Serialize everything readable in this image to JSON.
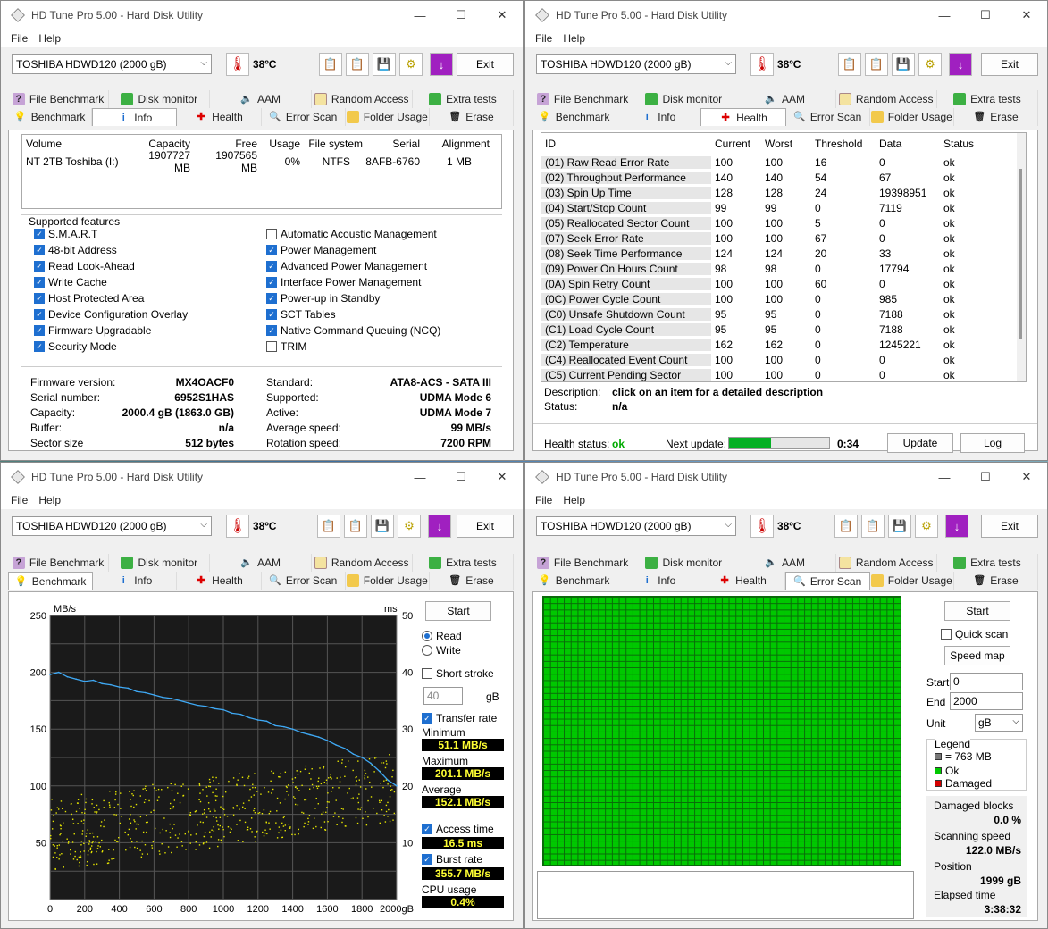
{
  "window": {
    "title": "HD Tune Pro 5.00 - Hard Disk Utility",
    "menu_file": "File",
    "menu_help": "Help",
    "exit_label": "Exit"
  },
  "drive": {
    "name": "TOSHIBA HDWD120 (2000 gB)",
    "temperature": "38ºC"
  },
  "tabs_row1": [
    "File Benchmark",
    "Disk monitor",
    "AAM",
    "Random Access",
    "Extra tests"
  ],
  "tabs_row2": [
    "Benchmark",
    "Info",
    "Health",
    "Error Scan",
    "Folder Usage",
    "Erase"
  ],
  "info": {
    "volume_headers": [
      "Volume",
      "Capacity",
      "Free",
      "Usage",
      "File system",
      "Serial",
      "Alignment"
    ],
    "volume_row": [
      "NT 2TB Toshiba (I:)",
      "1907727 MB",
      "1907565 MB",
      "0%",
      "NTFS",
      "8AFB-6760",
      "1 MB"
    ],
    "features_title": "Supported features",
    "features_left": [
      {
        "label": "S.M.A.R.T",
        "checked": true
      },
      {
        "label": "48-bit Address",
        "checked": true
      },
      {
        "label": "Read Look-Ahead",
        "checked": true
      },
      {
        "label": "Write Cache",
        "checked": true
      },
      {
        "label": "Host Protected Area",
        "checked": true
      },
      {
        "label": "Device Configuration Overlay",
        "checked": true
      },
      {
        "label": "Firmware Upgradable",
        "checked": true
      },
      {
        "label": "Security Mode",
        "checked": true
      }
    ],
    "features_right": [
      {
        "label": "Automatic Acoustic Management",
        "checked": false
      },
      {
        "label": "Power Management",
        "checked": true
      },
      {
        "label": "Advanced Power Management",
        "checked": true
      },
      {
        "label": "Interface Power Management",
        "checked": true
      },
      {
        "label": "Power-up in Standby",
        "checked": true
      },
      {
        "label": "SCT Tables",
        "checked": true
      },
      {
        "label": "Native Command Queuing (NCQ)",
        "checked": true
      },
      {
        "label": "TRIM",
        "checked": false
      }
    ],
    "specs_left": [
      {
        "label": "Firmware version:",
        "value": "MX4OACF0"
      },
      {
        "label": "Serial number:",
        "value": "6952S1HAS"
      },
      {
        "label": "Capacity:",
        "value": "2000.4 gB (1863.0 GB)"
      },
      {
        "label": "Buffer:",
        "value": "n/a"
      },
      {
        "label": "Sector size",
        "value": "512 bytes"
      }
    ],
    "specs_right": [
      {
        "label": "Standard:",
        "value": "ATA8-ACS - SATA III"
      },
      {
        "label": "Supported:",
        "value": "UDMA Mode 6"
      },
      {
        "label": "Active:",
        "value": "UDMA Mode 7"
      },
      {
        "label": "Average speed:",
        "value": "99 MB/s"
      },
      {
        "label": "Rotation speed:",
        "value": "7200 RPM"
      }
    ]
  },
  "health": {
    "headers": [
      "ID",
      "Current",
      "Worst",
      "Threshold",
      "Data",
      "Status"
    ],
    "rows": [
      [
        "(01) Raw Read Error Rate",
        "100",
        "100",
        "16",
        "0",
        "ok"
      ],
      [
        "(02) Throughput Performance",
        "140",
        "140",
        "54",
        "67",
        "ok"
      ],
      [
        "(03) Spin Up Time",
        "128",
        "128",
        "24",
        "19398951",
        "ok"
      ],
      [
        "(04) Start/Stop Count",
        "99",
        "99",
        "0",
        "7119",
        "ok"
      ],
      [
        "(05) Reallocated Sector Count",
        "100",
        "100",
        "5",
        "0",
        "ok"
      ],
      [
        "(07) Seek Error Rate",
        "100",
        "100",
        "67",
        "0",
        "ok"
      ],
      [
        "(08) Seek Time Performance",
        "124",
        "124",
        "20",
        "33",
        "ok"
      ],
      [
        "(09) Power On Hours Count",
        "98",
        "98",
        "0",
        "17794",
        "ok"
      ],
      [
        "(0A) Spin Retry Count",
        "100",
        "100",
        "60",
        "0",
        "ok"
      ],
      [
        "(0C) Power Cycle Count",
        "100",
        "100",
        "0",
        "985",
        "ok"
      ],
      [
        "(C0) Unsafe Shutdown Count",
        "95",
        "95",
        "0",
        "7188",
        "ok"
      ],
      [
        "(C1) Load Cycle Count",
        "95",
        "95",
        "0",
        "7188",
        "ok"
      ],
      [
        "(C2) Temperature",
        "162",
        "162",
        "0",
        "1245221",
        "ok"
      ],
      [
        "(C4) Reallocated Event Count",
        "100",
        "100",
        "0",
        "0",
        "ok"
      ],
      [
        "(C5) Current Pending Sector",
        "100",
        "100",
        "0",
        "0",
        "ok"
      ]
    ],
    "description_label": "Description:",
    "description_value": "click on an item for a detailed description",
    "status_label": "Status:",
    "status_value": "n/a",
    "health_status_label": "Health status:",
    "health_status_value": "ok",
    "next_update_label": "Next update:",
    "next_update_progress": 0.42,
    "next_update_time": "0:34",
    "update_button": "Update",
    "log_button": "Log"
  },
  "benchmark": {
    "start_button": "Start",
    "read_label": "Read",
    "write_label": "Write",
    "short_stroke_label": "Short stroke",
    "short_stroke_value": "40",
    "short_stroke_unit": "gB",
    "transfer_rate_label": "Transfer rate",
    "minimum_label": "Minimum",
    "minimum_value": "51.1 MB/s",
    "maximum_label": "Maximum",
    "maximum_value": "201.1 MB/s",
    "average_label": "Average",
    "average_value": "152.1 MB/s",
    "access_time_label": "Access time",
    "access_time_value": "16.5 ms",
    "burst_rate_label": "Burst rate",
    "burst_rate_value": "355.7 MB/s",
    "cpu_usage_label": "CPU usage",
    "cpu_usage_value": "0.4%"
  },
  "chart_data": {
    "type": "line",
    "ylabel": "MB/s",
    "y2label": "ms",
    "xlabel_unit": "gB",
    "ylim": [
      0,
      250
    ],
    "y2lim": [
      0,
      50
    ],
    "xlim": [
      0,
      2000
    ],
    "x_ticks": [
      "0",
      "200",
      "400",
      "600",
      "800",
      "1000",
      "1200",
      "1400",
      "1600",
      "1800",
      "2000gB"
    ],
    "y_ticks": [
      "50",
      "100",
      "150",
      "200",
      "250"
    ],
    "y2_ticks": [
      "10",
      "20",
      "30",
      "40",
      "50"
    ],
    "series": [
      {
        "color": "#3fa9f5",
        "x": [
          0,
          50,
          100,
          150,
          200,
          250,
          300,
          350,
          400,
          450,
          500,
          550,
          600,
          650,
          700,
          750,
          800,
          850,
          900,
          950,
          1000,
          1050,
          1100,
          1150,
          1200,
          1250,
          1300,
          1350,
          1400,
          1450,
          1500,
          1550,
          1600,
          1650,
          1700,
          1750,
          1800,
          1850,
          1900,
          1950,
          2000
        ],
        "y": [
          198,
          200,
          196,
          194,
          192,
          193,
          190,
          189,
          187,
          186,
          183,
          182,
          180,
          178,
          177,
          175,
          173,
          171,
          170,
          168,
          167,
          164,
          163,
          160,
          158,
          157,
          153,
          152,
          150,
          147,
          145,
          143,
          140,
          136,
          133,
          128,
          125,
          120,
          113,
          105,
          100
        ]
      },
      {
        "color": "#e6e600",
        "type": "scatter",
        "x_range": [
          0,
          2000
        ],
        "y2_range_start": [
          5,
          18
        ],
        "y2_range_end": [
          14,
          26
        ]
      }
    ]
  },
  "error_scan": {
    "start_button": "Start",
    "quick_scan_label": "Quick scan",
    "speed_map_button": "Speed map",
    "start_label": "Start",
    "start_value": "0",
    "end_label": "End",
    "end_value": "2000",
    "unit_label": "Unit",
    "unit_value": "gB",
    "legend_title": "Legend",
    "legend_block": "= 763 MB",
    "legend_ok": "Ok",
    "legend_damaged": "Damaged",
    "damaged_blocks_label": "Damaged blocks",
    "damaged_blocks_value": "0.0 %",
    "scanning_speed_label": "Scanning speed",
    "scanning_speed_value": "122.0 MB/s",
    "position_label": "Position",
    "position_value": "1999 gB",
    "elapsed_time_label": "Elapsed time",
    "elapsed_time_value": "3:38:32",
    "colors": {
      "ok": "#00c800",
      "damaged": "#d40000",
      "block": "#777777"
    }
  }
}
